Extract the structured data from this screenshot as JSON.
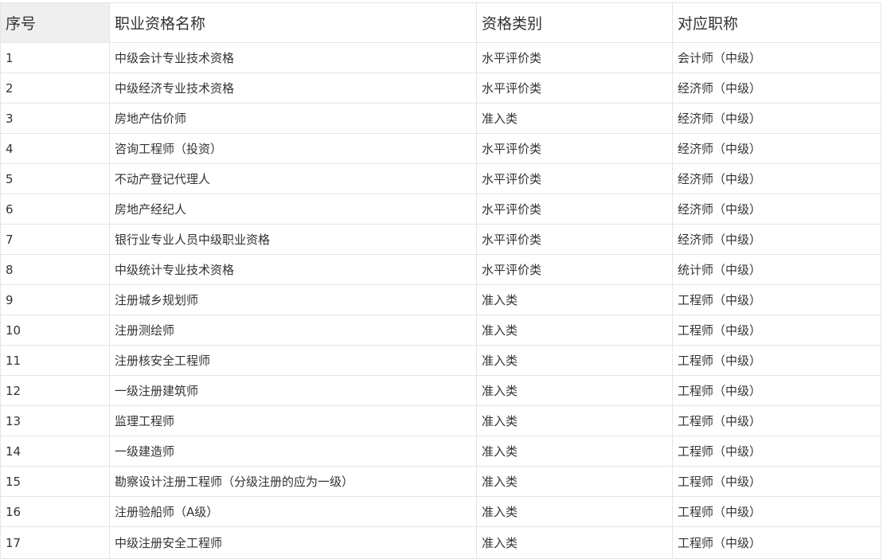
{
  "table": {
    "headers": [
      "序号",
      "职业资格名称",
      "资格类别",
      "对应职称"
    ],
    "rows": [
      [
        "1",
        "中级会计专业技术资格",
        "水平评价类",
        "会计师（中级）"
      ],
      [
        "2",
        "中级经济专业技术资格",
        "水平评价类",
        "经济师（中级）"
      ],
      [
        "3",
        "房地产估价师",
        "准入类",
        "经济师（中级）"
      ],
      [
        "4",
        "咨询工程师（投资）",
        "水平评价类",
        "经济师（中级）"
      ],
      [
        "5",
        "不动产登记代理人",
        "水平评价类",
        "经济师（中级）"
      ],
      [
        "6",
        "房地产经纪人",
        "水平评价类",
        "经济师（中级）"
      ],
      [
        "7",
        "银行业专业人员中级职业资格",
        "水平评价类",
        "经济师（中级）"
      ],
      [
        "8",
        "中级统计专业技术资格",
        "水平评价类",
        "统计师（中级）"
      ],
      [
        "9",
        "注册城乡规划师",
        "准入类",
        "工程师（中级）"
      ],
      [
        "10",
        "注册测绘师",
        "准入类",
        "工程师（中级）"
      ],
      [
        "11",
        "注册核安全工程师",
        "准入类",
        "工程师（中级）"
      ],
      [
        "12",
        "一级注册建筑师",
        "准入类",
        "工程师（中级）"
      ],
      [
        "13",
        "监理工程师",
        "准入类",
        "工程师（中级）"
      ],
      [
        "14",
        "一级建造师",
        "准入类",
        "工程师（中级）"
      ],
      [
        "15",
        "勘察设计注册工程师（分级注册的应为一级）",
        "准入类",
        "工程师（中级）"
      ],
      [
        "16",
        "注册验船师（A级）",
        "准入类",
        "工程师（中级）"
      ],
      [
        "17",
        "中级注册安全工程师",
        "准入类",
        "工程师（中级）"
      ]
    ]
  }
}
